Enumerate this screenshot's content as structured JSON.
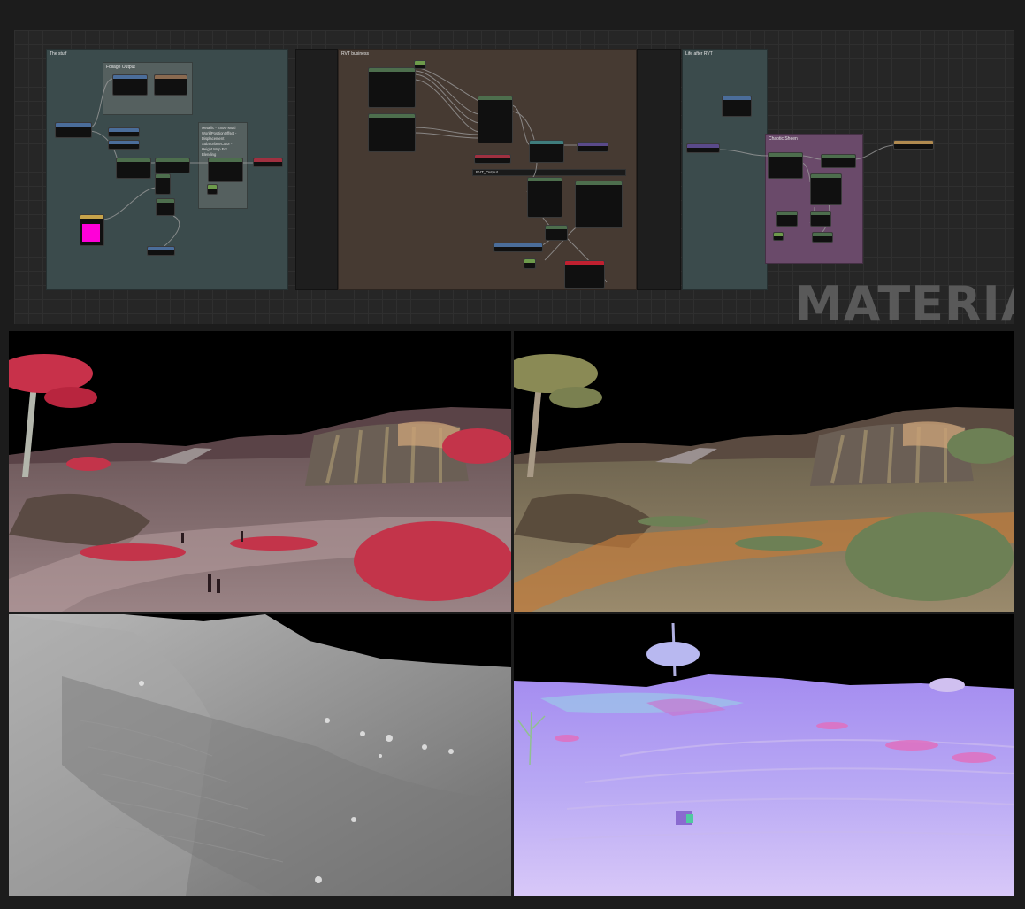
{
  "watermark": "MATERIAL",
  "comment_groups": [
    {
      "title": "The stuff"
    },
    {
      "title": "Foliage Output"
    },
    {
      "title": "RVT business"
    },
    {
      "title": "RVT_Output"
    },
    {
      "title": "Life after RVT"
    },
    {
      "title": "Chaotic Sheen"
    }
  ],
  "note_text": "Metallic - Snow Multi\nWorldPositionOffset -\nDisplacement\nSubSurfaceColor -\nHeight Map For\nBlending",
  "colors": {
    "graph_bg": "#262626",
    "stuff_group": "#3b4b4c",
    "rvt_group": "#463a32",
    "life_group": "#3b4b4c",
    "sheen_group": "#6a4a6a",
    "magenta_swatch": "#ff00d8",
    "node_bg": "#101010"
  },
  "viewports": [
    {
      "name": "base-color-view",
      "palette": "red-tint"
    },
    {
      "name": "albedo-view",
      "palette": "natural"
    },
    {
      "name": "height-view",
      "palette": "grayscale"
    },
    {
      "name": "normal-view",
      "palette": "normal-map"
    }
  ]
}
